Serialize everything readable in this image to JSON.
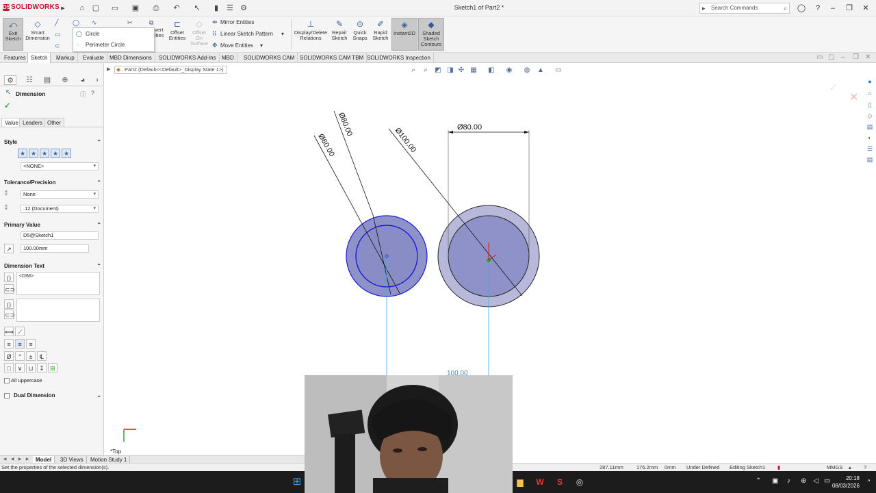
{
  "app": {
    "logo_text": "SOLIDWORKS",
    "document_title": "Sketch1 of Part2 *",
    "search_placeholder": "Search Commands"
  },
  "ribbon": {
    "exit_sketch": [
      "Exit",
      "Sketch"
    ],
    "smart_dimension": [
      "Smart",
      "Dimension"
    ],
    "circle_menu": [
      "Circle",
      "Perimeter Circle"
    ],
    "convert_entities_partial": [
      "vert",
      "ities"
    ],
    "offset_entities": [
      "Offset",
      "Entities"
    ],
    "offset_on_surface": [
      "Offset",
      "On",
      "Surface"
    ],
    "mirror_entities": "Mirror Entities",
    "linear_sketch_pattern": "Linear Sketch Pattern",
    "move_entities": "Move Entities",
    "display_delete_relations": [
      "Display/Delete",
      "Relations"
    ],
    "repair_sketch": [
      "Repair",
      "Sketch"
    ],
    "quick_snaps": [
      "Quick",
      "Snaps"
    ],
    "rapid_sketch": [
      "Rapid",
      "Sketch"
    ],
    "instant2d": "Instant2D",
    "shaded_sketch_contours": [
      "Shaded",
      "Sketch",
      "Contours"
    ]
  },
  "tabs": [
    "Features",
    "Sketch",
    "Markup",
    "Evaluate",
    "MBD Dimensions",
    "SOLIDWORKS Add-Ins",
    "MBD",
    "SOLIDWORKS CAM",
    "SOLIDWORKS CAM TBM",
    "SOLIDWORKS Inspection"
  ],
  "active_tab": "Sketch",
  "property_manager": {
    "title": "Dimension",
    "subtabs": [
      "Value",
      "Leaders",
      "Other"
    ],
    "style_header": "Style",
    "style_value": "<NONE>",
    "tolerance_header": "Tolerance/Precision",
    "tolerance_value": "None",
    "precision_value": ".12 (Document)",
    "primary_value_header": "Primary Value",
    "primary_name": "D5@Sketch1",
    "primary_value": "100.00mm",
    "dimension_text_header": "Dimension Text",
    "dimension_text": "<DIM>",
    "all_uppercase": "All uppercase",
    "dual_dimension": "Dual Dimension"
  },
  "canvas": {
    "breadcrumb": "Part2 (Default<<Default>_Display State 1>)",
    "view_label": "*Top"
  },
  "drawing": {
    "dim_left_outer": "Ø80.00",
    "dim_left_inner": "Ø60.00",
    "dim_right_diag": "Ø100.00",
    "dim_right_horiz": "Ø80.00",
    "dim_spacing": "100.00",
    "circle_fill": "#8f92c8",
    "sketch_blue": "#1a1adb"
  },
  "model_tabs": [
    "Model",
    "3D Views",
    "Motion Study 1"
  ],
  "status": {
    "hint": "Set the properties of the selected dimension(s).",
    "x": "287.11mm",
    "y": "176.2mm",
    "z": "0mm",
    "state": "Under Defined",
    "editing": "Editing Sketch1",
    "units": "MMGS"
  },
  "clock": {
    "time": "20:18",
    "date": "08/03/2026"
  }
}
